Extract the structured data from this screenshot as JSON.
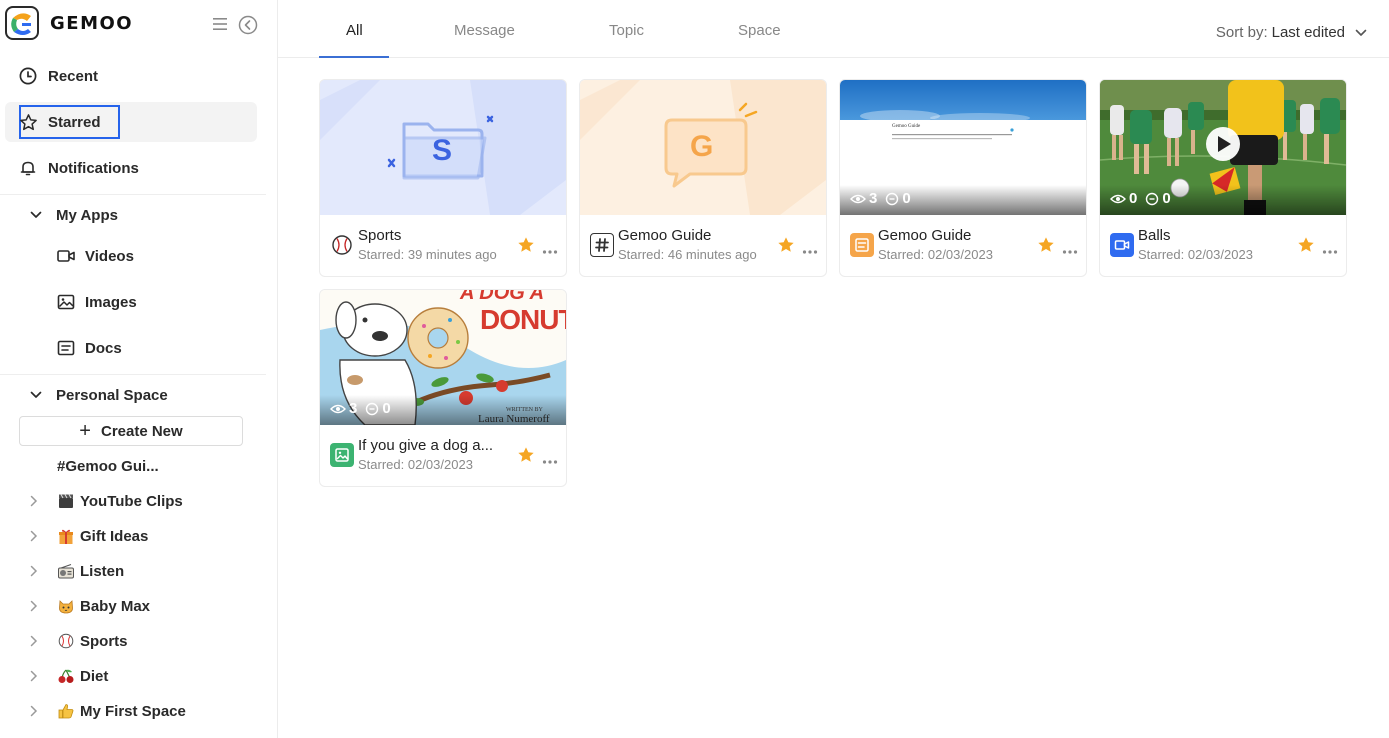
{
  "brand": {
    "name": "GEMOO"
  },
  "nav": {
    "recent": "Recent",
    "starred": "Starred",
    "notifications": "Notifications"
  },
  "my_apps": {
    "title": "My Apps",
    "items": [
      {
        "label": "Videos",
        "icon": "video-icon"
      },
      {
        "label": "Images",
        "icon": "image-icon"
      },
      {
        "label": "Docs",
        "icon": "doc-icon"
      }
    ]
  },
  "personal_space": {
    "title": "Personal Space",
    "create_new": "Create New",
    "guide": "#Gemoo Gui...",
    "spaces": [
      {
        "label": "YouTube Clips",
        "emoji": "🎬"
      },
      {
        "label": "Gift Ideas",
        "emoji": "🎁"
      },
      {
        "label": "Listen",
        "emoji": "📻"
      },
      {
        "label": "Baby Max",
        "emoji": "🐱"
      },
      {
        "label": "Sports",
        "emoji": "⚾"
      },
      {
        "label": "Diet",
        "emoji": "🍒"
      },
      {
        "label": "My First Space",
        "emoji": "👍"
      }
    ]
  },
  "tabs": [
    "All",
    "Message",
    "Topic",
    "Space"
  ],
  "sort": {
    "label": "Sort by:",
    "value": "Last edited"
  },
  "cards": [
    {
      "title": "Sports",
      "subtitle": "Starred: 39 minutes ago",
      "type": "space",
      "views": "",
      "comments": ""
    },
    {
      "title": "Gemoo Guide",
      "subtitle": "Starred: 46 minutes ago",
      "type": "topic",
      "views": "",
      "comments": ""
    },
    {
      "title": "Gemoo Guide",
      "subtitle": "Starred: 02/03/2023",
      "type": "doc",
      "views": "3",
      "comments": "0"
    },
    {
      "title": "Balls",
      "subtitle": "Starred: 02/03/2023",
      "type": "video",
      "views": "0",
      "comments": "0"
    },
    {
      "title": "If you give a dog a...",
      "subtitle": "Starred: 02/03/2023",
      "type": "image",
      "views": "3",
      "comments": "0"
    }
  ],
  "thumb_text": {
    "space_letter": "S",
    "topic_letter": "G",
    "doc_heading": "Gemoo Guide",
    "book_title": "DONUT",
    "book_title_top": "A DOG A",
    "book_author_label": "WRITTEN BY",
    "book_author": "Laura Numeroff"
  },
  "colors": {
    "accent": "#3b6fd4",
    "star": "#f5a623",
    "highlight_box": "#2563eb",
    "doc_icon": "#f5a54a",
    "video_icon": "#2f6bf0",
    "image_icon": "#3cb371"
  }
}
